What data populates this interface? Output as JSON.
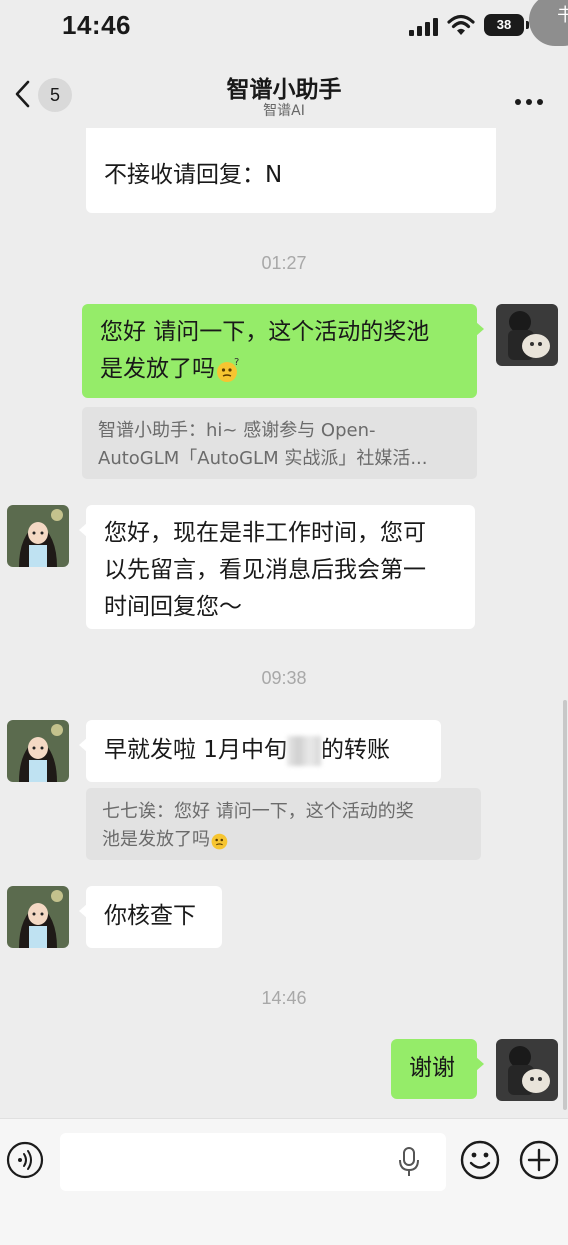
{
  "status_bar": {
    "time": "14:46",
    "battery": "38",
    "floating_button": "书"
  },
  "header": {
    "unread_count": "5",
    "title": "智谱小助手",
    "subtitle": "智谱AI"
  },
  "messages": {
    "m0": {
      "text": "不接收请回复：N"
    },
    "t1": "01:27",
    "m1": {
      "line1": "您好 请问一下，这个活动的奖池",
      "line2": "是发放了吗",
      "quote_line1": "智谱小助手：hi~ 感谢参与 Open-",
      "quote_line2": "AutoGLM「AutoGLM 实战派」社媒活..."
    },
    "m2": {
      "line1": "您好，现在是非工作时间，您可",
      "line2": "以先留言，看见消息后我会第一",
      "line3": "时间回复您～"
    },
    "t2": "09:38",
    "m3": {
      "text_before": "早就发啦 1月中旬",
      "text_after": "的转账",
      "quote_line1": "七七诶：您好 请问一下，这个活动的奖",
      "quote_line2": "池是发放了吗"
    },
    "m4": {
      "text": "你核查下"
    },
    "t3": "14:46",
    "m5": {
      "text": "谢谢"
    }
  },
  "input": {
    "placeholder": ""
  },
  "colors": {
    "background": "#ededed",
    "sent_bubble": "#95ec69",
    "received_bubble": "#ffffff",
    "quote_bg": "#e2e2e2"
  },
  "icons": {
    "back": "chevron-left-icon",
    "more": "more-icon",
    "voice": "voice-icon",
    "mic": "microphone-icon",
    "emoji": "emoji-icon",
    "add": "plus-icon"
  }
}
